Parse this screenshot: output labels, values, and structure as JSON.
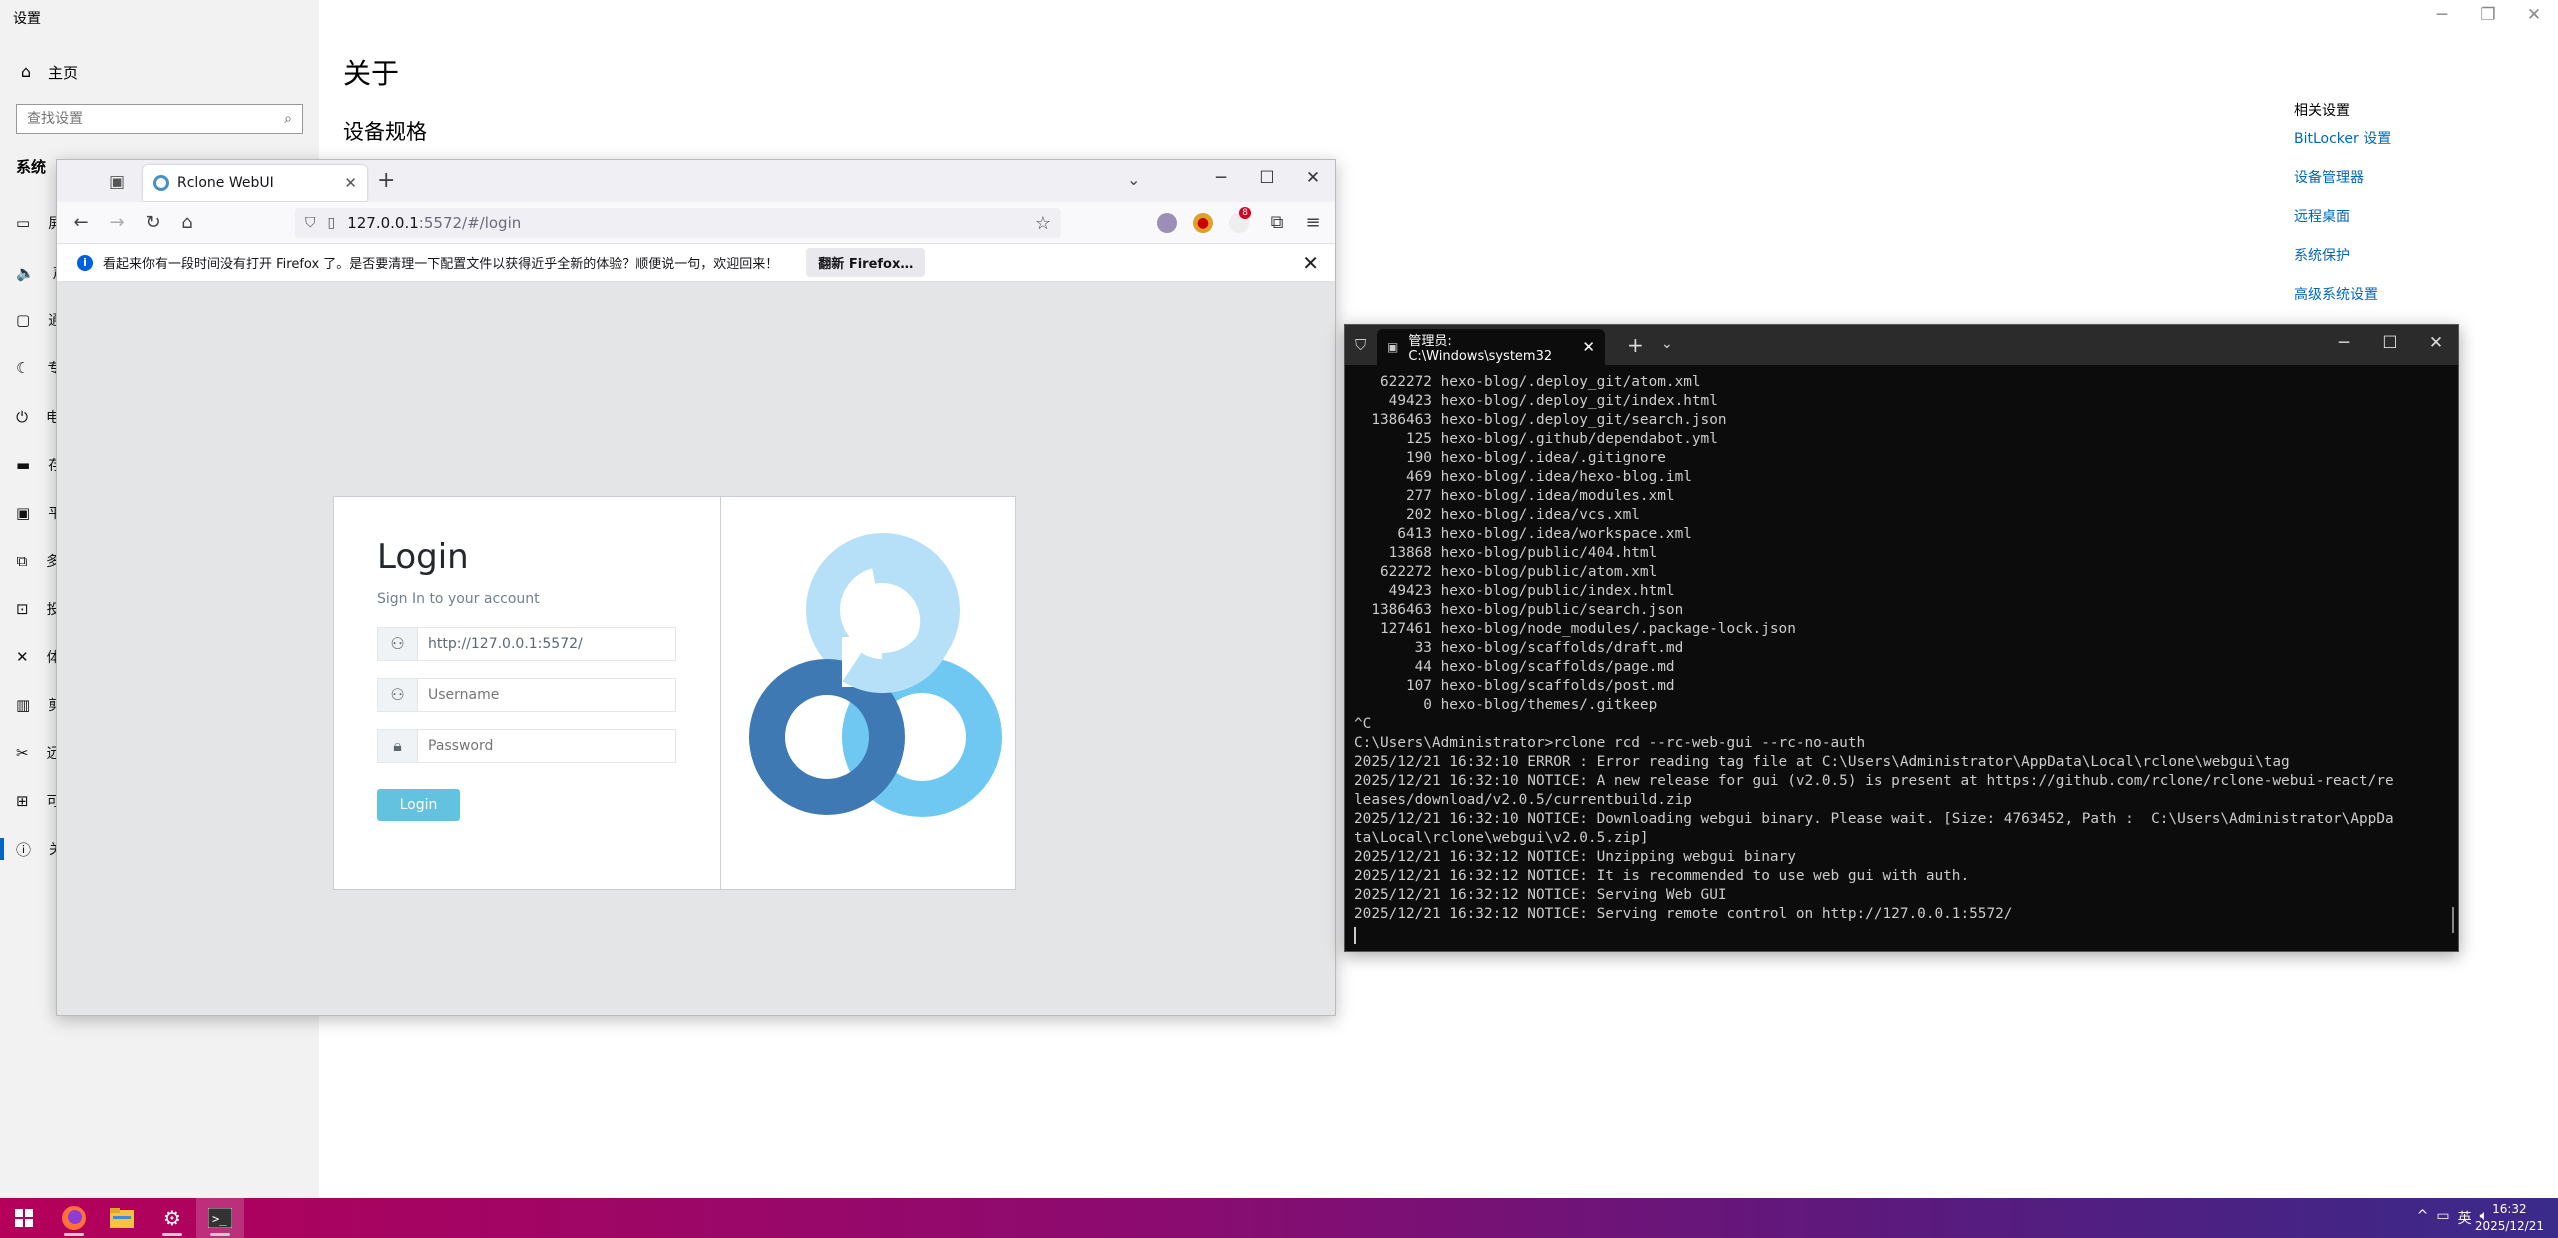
{
  "settings": {
    "title": "设置",
    "home": "主页",
    "search_placeholder": "查找设置",
    "section": "系统",
    "side_items": [
      {
        "icon": "display-icon",
        "glyph": "▭",
        "label": "屏"
      },
      {
        "icon": "sound-icon",
        "glyph": "🔈",
        "label": "声"
      },
      {
        "icon": "notification-icon",
        "glyph": "▢",
        "label": "通"
      },
      {
        "icon": "focus-icon",
        "glyph": "☾",
        "label": "专"
      },
      {
        "icon": "power-icon",
        "glyph": "⏻",
        "label": "电"
      },
      {
        "icon": "storage-icon",
        "glyph": "▬",
        "label": "存"
      },
      {
        "icon": "tablet-icon",
        "glyph": "▣",
        "label": "平"
      },
      {
        "icon": "multitask-icon",
        "glyph": "⧉",
        "label": "多"
      },
      {
        "icon": "project-icon",
        "glyph": "⊡",
        "label": "投"
      },
      {
        "icon": "shared-icon",
        "glyph": "✕",
        "label": "体"
      },
      {
        "icon": "clipboard-icon",
        "glyph": "▥",
        "label": "剪"
      },
      {
        "icon": "remote-icon",
        "glyph": "✂",
        "label": "远"
      },
      {
        "icon": "optional-icon",
        "glyph": "⊞",
        "label": "可"
      },
      {
        "icon": "about-icon",
        "glyph": "ⓘ",
        "label": "关"
      }
    ],
    "heading": "关于",
    "subheading": "设备规格",
    "related_title": "相关设置",
    "related_links": [
      "BitLocker 设置",
      "设备管理器",
      "远程桌面",
      "系统保护",
      "高级系统设置"
    ]
  },
  "firefox": {
    "tab_title": "Rclone WebUI",
    "url_host": "127.0.0.1",
    "url_path": ":5572/#/login",
    "notice_text": "看起来你有一段时间没有打开 Firefox 了。是否要清理一下配置文件以获得近乎全新的体验？顺便说一句，欢迎回来！",
    "notice_button": "翻新 Firefox…",
    "badge_1": "8"
  },
  "login": {
    "title": "Login",
    "subtitle": "Sign In to your account",
    "url_value": "http://127.0.0.1:5572/",
    "username_placeholder": "Username",
    "password_placeholder": "Password",
    "button": "Login"
  },
  "terminal": {
    "tab_title": "管理员: C:\\Windows\\system32",
    "lines": [
      "   622272 hexo-blog/.deploy_git/atom.xml",
      "    49423 hexo-blog/.deploy_git/index.html",
      "  1386463 hexo-blog/.deploy_git/search.json",
      "      125 hexo-blog/.github/dependabot.yml",
      "      190 hexo-blog/.idea/.gitignore",
      "      469 hexo-blog/.idea/hexo-blog.iml",
      "      277 hexo-blog/.idea/modules.xml",
      "      202 hexo-blog/.idea/vcs.xml",
      "     6413 hexo-blog/.idea/workspace.xml",
      "    13868 hexo-blog/public/404.html",
      "   622272 hexo-blog/public/atom.xml",
      "    49423 hexo-blog/public/index.html",
      "  1386463 hexo-blog/public/search.json",
      "   127461 hexo-blog/node_modules/.package-lock.json",
      "       33 hexo-blog/scaffolds/draft.md",
      "       44 hexo-blog/scaffolds/page.md",
      "      107 hexo-blog/scaffolds/post.md",
      "        0 hexo-blog/themes/.gitkeep",
      "^C",
      "C:\\Users\\Administrator>rclone rcd --rc-web-gui --rc-no-auth",
      "2025/12/21 16:32:10 ERROR : Error reading tag file at C:\\Users\\Administrator\\AppData\\Local\\rclone\\webgui\\tag",
      "2025/12/21 16:32:10 NOTICE: A new release for gui (v2.0.5) is present at https://github.com/rclone/rclone-webui-react/re",
      "leases/download/v2.0.5/currentbuild.zip",
      "2025/12/21 16:32:10 NOTICE: Downloading webgui binary. Please wait. [Size: 4763452, Path :  C:\\Users\\Administrator\\AppDa",
      "ta\\Local\\rclone\\webgui\\v2.0.5.zip]",
      "2025/12/21 16:32:12 NOTICE: Unzipping webgui binary",
      "2025/12/21 16:32:12 NOTICE: It is recommended to use web gui with auth.",
      "2025/12/21 16:32:12 NOTICE: Serving Web GUI",
      "2025/12/21 16:32:12 NOTICE: Serving remote control on http://127.0.0.1:5572/"
    ]
  },
  "taskbar": {
    "ime": "英",
    "time": "16:32",
    "date": "2025/12/21"
  },
  "colors": {
    "accent": "#0067c0",
    "login_button": "#63c2de",
    "logo_light": "#b6e0f7",
    "logo_mid": "#6ec8f2",
    "logo_dark": "#3f79b3"
  }
}
